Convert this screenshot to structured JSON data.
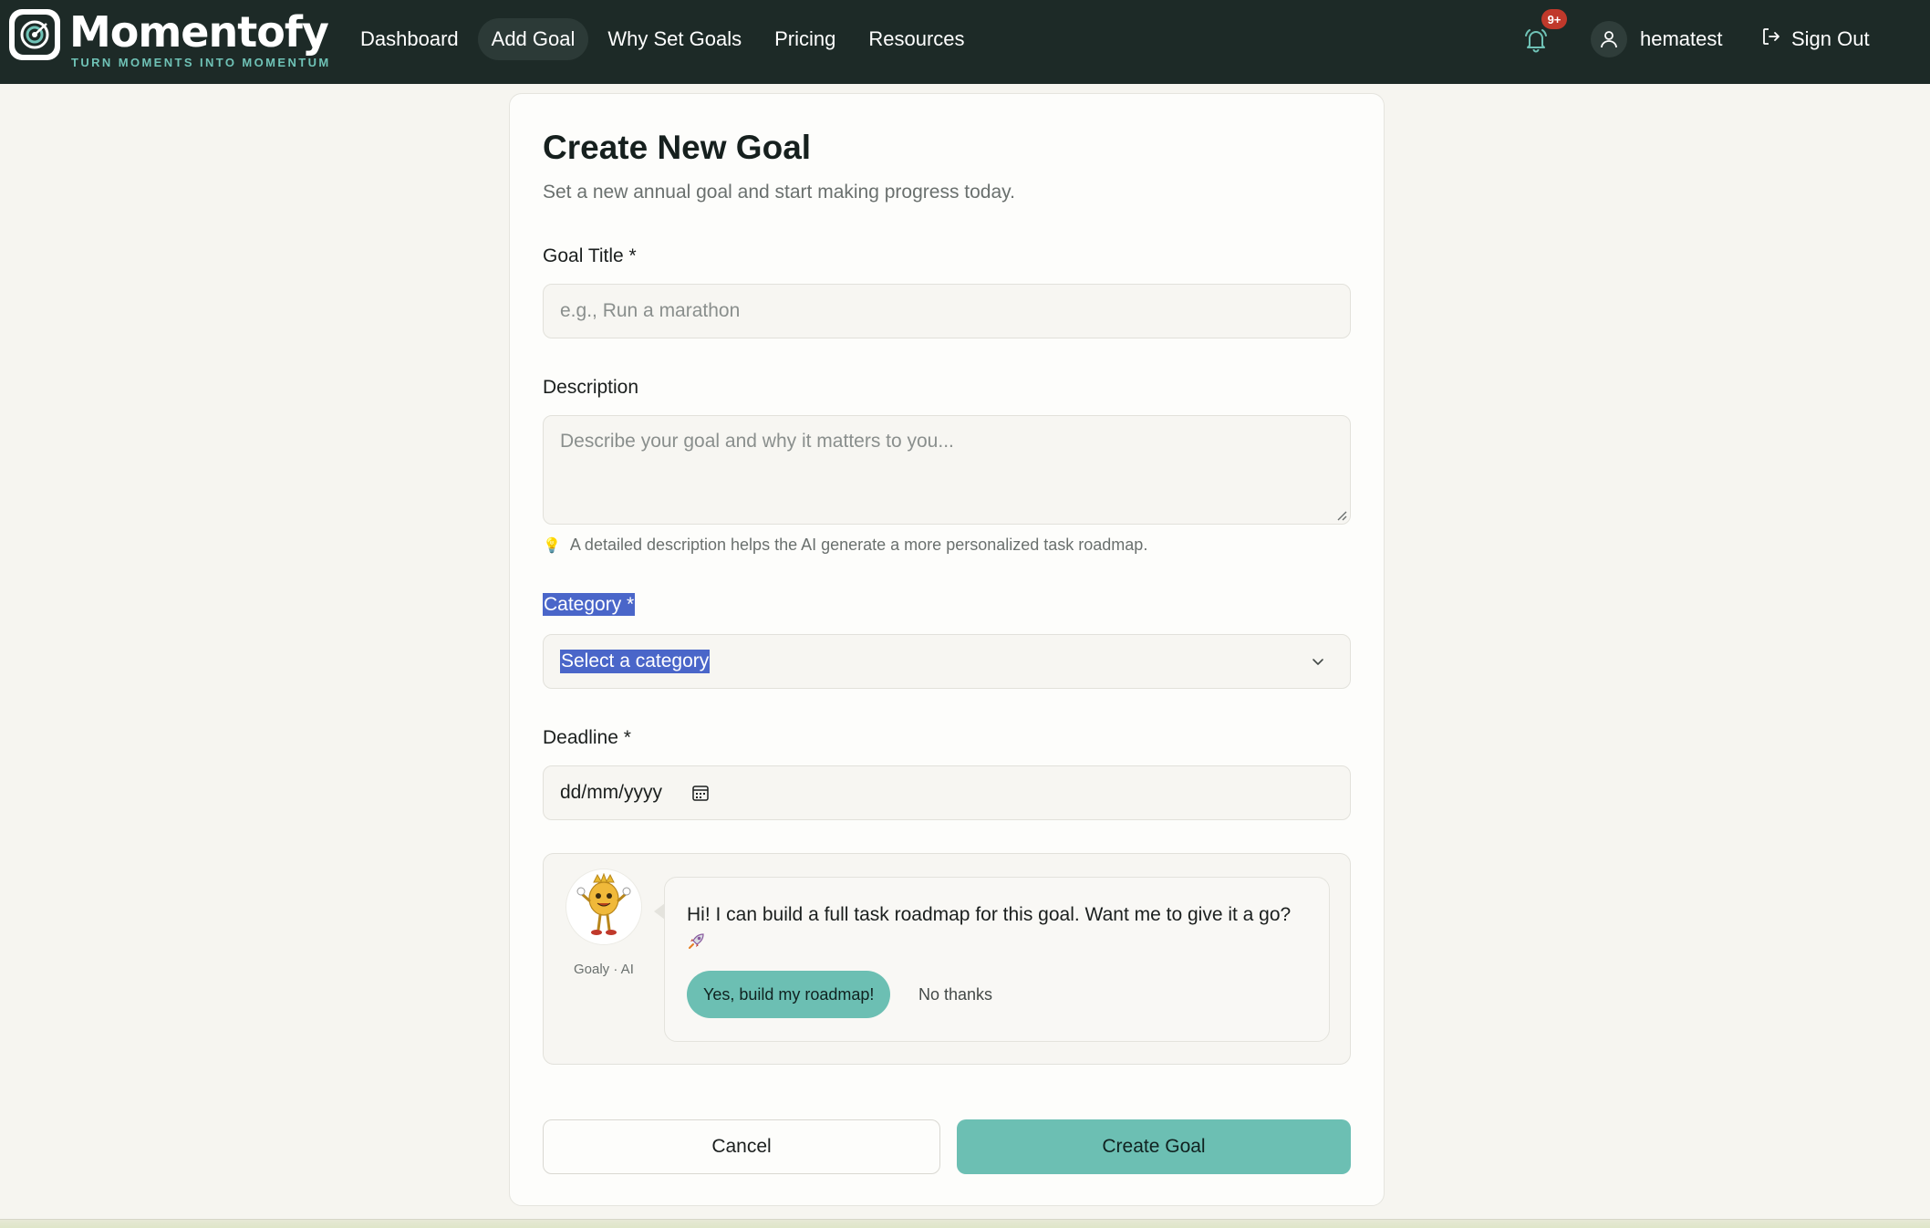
{
  "brand": {
    "name": "Momentofy",
    "tagline": "TURN MOMENTS INTO MOMENTUM"
  },
  "nav": {
    "items": [
      {
        "label": "Dashboard",
        "active": false
      },
      {
        "label": "Add Goal",
        "active": true
      },
      {
        "label": "Why Set Goals",
        "active": false
      },
      {
        "label": "Pricing",
        "active": false
      },
      {
        "label": "Resources",
        "active": false
      }
    ],
    "notifications_badge": "9+",
    "username": "hematest",
    "signout_label": "Sign Out"
  },
  "form": {
    "title": "Create New Goal",
    "subtitle": "Set a new annual goal and start making progress today.",
    "goal_title_label": "Goal Title *",
    "goal_title_placeholder": "e.g., Run a marathon",
    "description_label": "Description",
    "description_placeholder": "Describe your goal and why it matters to you...",
    "description_hint": "A detailed description helps the AI generate a more personalized task roadmap.",
    "category_label": "Category *",
    "category_value": "Select a category",
    "deadline_label": "Deadline *",
    "deadline_value": "dd/mm/yyyy",
    "cancel_label": "Cancel",
    "create_label": "Create Goal"
  },
  "ai": {
    "assistant_label": "Goaly · AI",
    "message": "Hi! I can build a full task roadmap for this goal. Want me to give it a go?",
    "yes_label": "Yes, build my roadmap!",
    "no_label": "No thanks"
  },
  "colors": {
    "topbar": "#1d2a27",
    "accent": "#6cbfb3",
    "selection": "#4a66c9",
    "badge": "#c0392b"
  }
}
